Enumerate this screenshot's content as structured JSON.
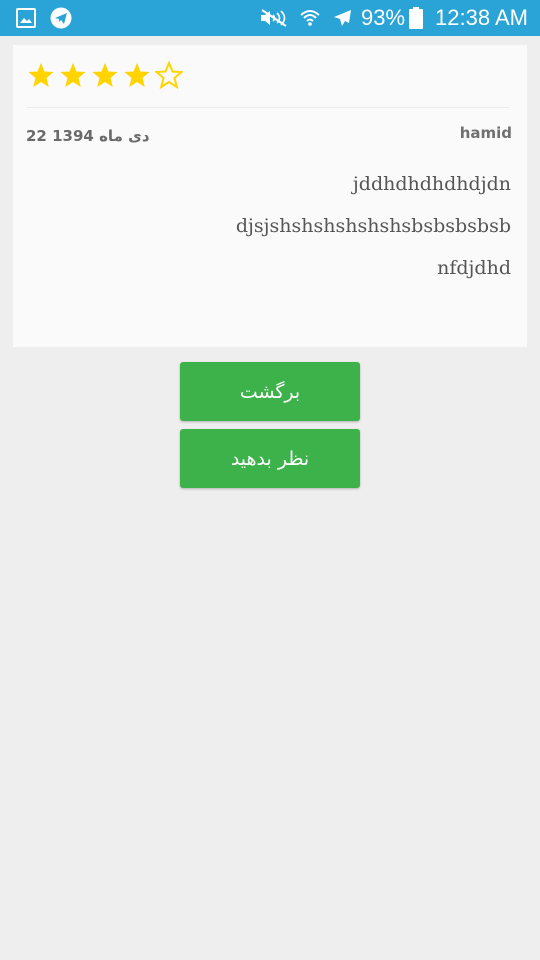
{
  "status_bar": {
    "battery": "93%",
    "time": "12:38 AM",
    "icons": [
      "gallery-icon",
      "telegram-icon",
      "mute-icon",
      "wifi-icon",
      "airplane-icon",
      "battery-icon"
    ]
  },
  "review": {
    "rating": 4,
    "max_rating": 5,
    "star_color": "#ffd400",
    "author": "hamid",
    "date": "22 دی ماه  1394",
    "lines": [
      "jddhdhdhdhdjdn",
      "djsjshshshshshshsbsbsbsbsb",
      "nfdjdhd"
    ]
  },
  "buttons": {
    "back_label": "برگشت",
    "comment_label": "نظر بدهید",
    "color": "#3db24a"
  },
  "colors": {
    "status_bar": "#2aa4d6",
    "background": "#eeeeee"
  }
}
